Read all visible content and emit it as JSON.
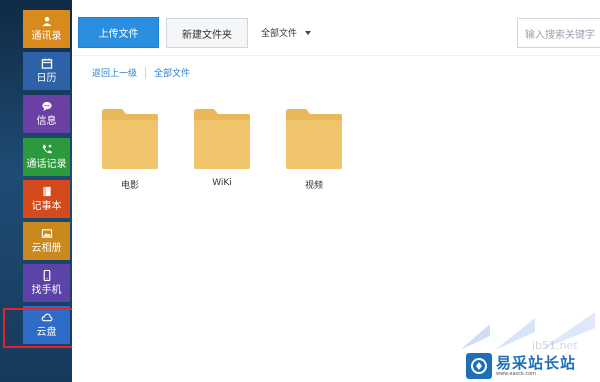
{
  "sidebar": {
    "items": [
      {
        "label": "通讯录",
        "icon": "contacts-icon"
      },
      {
        "label": "日历",
        "icon": "calendar-icon"
      },
      {
        "label": "信息",
        "icon": "message-icon"
      },
      {
        "label": "通话记录",
        "icon": "call-log-icon"
      },
      {
        "label": "记事本",
        "icon": "notebook-icon"
      },
      {
        "label": "云相册",
        "icon": "photo-album-icon"
      },
      {
        "label": "找手机",
        "icon": "phone-icon"
      },
      {
        "label": "云盘",
        "icon": "cloud-icon"
      }
    ],
    "highlight_color": "#e8222a"
  },
  "toolbar": {
    "upload_label": "上传文件",
    "new_folder_label": "新建文件夹",
    "filter_label": "全部文件",
    "search_placeholder": "输入搜索关键字"
  },
  "breadcrumb": {
    "back_label": "返回上一级",
    "current_label": "全部文件"
  },
  "folders": [
    {
      "name": "电影"
    },
    {
      "name": "WiKi"
    },
    {
      "name": "视频"
    }
  ],
  "watermark": {
    "title": "易采站长站",
    "subtitle": "www.easck.com",
    "ghost": "jb51.net"
  },
  "colors": {
    "accent": "#2a8fe0",
    "folder": "#e8b85a",
    "link": "#2a7fd0"
  }
}
